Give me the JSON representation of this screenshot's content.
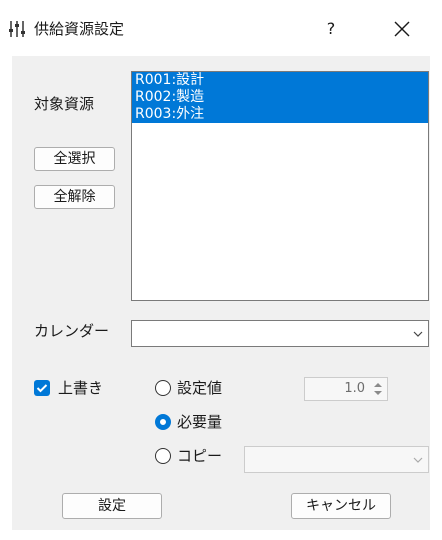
{
  "dialog": {
    "title": "供給資源設定",
    "help_label": "?"
  },
  "resources": {
    "label": "対象資源",
    "select_all_label": "全選択",
    "deselect_all_label": "全解除",
    "items": [
      "R001:設計",
      "R002:製造",
      "R003:外注"
    ]
  },
  "calendar": {
    "label": "カレンダー",
    "value": ""
  },
  "overwrite": {
    "label": "上書き",
    "checked": true
  },
  "mode": {
    "options": [
      "設定値",
      "必要量",
      "コピー"
    ],
    "selected": "必要量",
    "setting_value": "1.0",
    "copy_value": ""
  },
  "footer": {
    "apply_label": "設定",
    "cancel_label": "キャンセル"
  },
  "colors": {
    "accent": "#0078d7",
    "window_bg": "#f0f0f0"
  }
}
